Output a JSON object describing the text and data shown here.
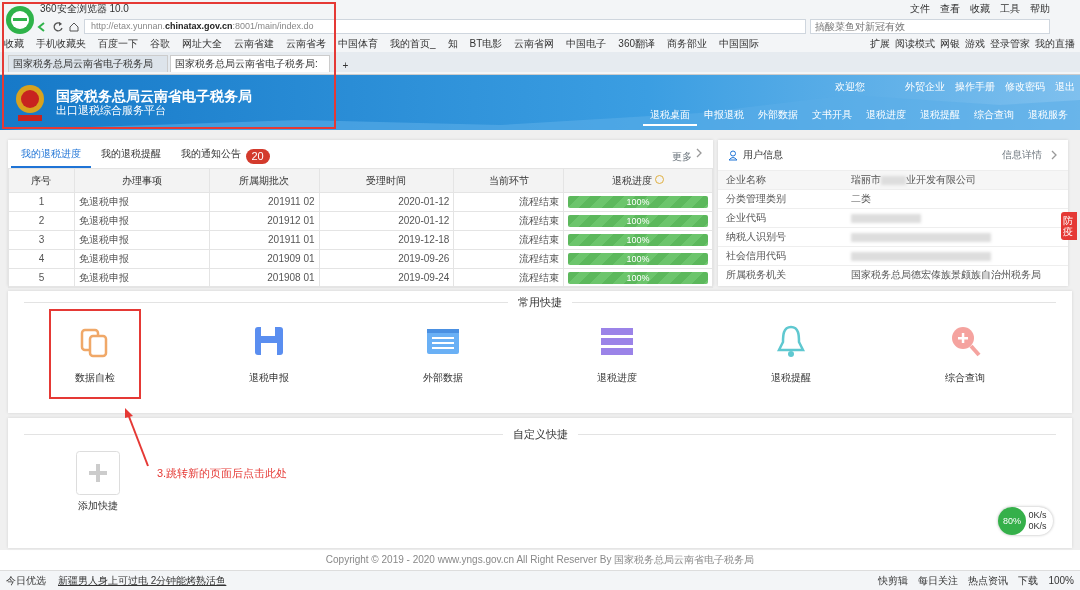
{
  "browser": {
    "title": "360安全浏览器 10.0",
    "menu": [
      "文件",
      "查看",
      "收藏",
      "工具",
      "帮助"
    ],
    "url": {
      "prefix": "http://etax.yunnan.",
      "domain": "chinatax.gov.cn",
      "suffix": ":8001/main/index.do"
    },
    "search": {
      "placeholder": "搞酸菜鱼对新冠有效"
    },
    "bookmarks": [
      "收藏",
      "手机收藏夹",
      "百度一下",
      "谷歌",
      "网址大全",
      "云南省建",
      "云南省考",
      "中国体育",
      "我的首页_",
      "知",
      "BT电影",
      "云南省网",
      "中国电子",
      "360翻译",
      "商务部业",
      "中国国际"
    ],
    "bookmarks_right": [
      "扩展",
      "阅读模式",
      "网银",
      "游戏",
      "登录管家",
      "我的直播"
    ],
    "tabs": [
      {
        "label": "国家税务总局云南省电子税务局",
        "selected": false
      },
      {
        "label": "国家税务总局云南省电子税务局:",
        "selected": true
      }
    ],
    "new_tab": "+"
  },
  "header": {
    "title": "国家税务总局云南省电子税务局",
    "subtitle": "出口退税综合服务平台",
    "welcome": "欢迎您",
    "links": [
      "外贸企业",
      "操作手册",
      "修改密码",
      "退出"
    ],
    "nav": [
      {
        "label": "退税桌面",
        "selected": true
      },
      {
        "label": "申报退税",
        "selected": false
      },
      {
        "label": "外部数据",
        "selected": false
      },
      {
        "label": "文书开具",
        "selected": false
      },
      {
        "label": "退税进度",
        "selected": false
      },
      {
        "label": "退税提醒",
        "selected": false
      },
      {
        "label": "综合查询",
        "selected": false
      },
      {
        "label": "退税服务",
        "selected": false
      }
    ]
  },
  "progress_panel": {
    "tabs": [
      {
        "label": "我的退税进度",
        "selected": true
      },
      {
        "label": "我的退税提醒",
        "selected": false
      },
      {
        "label": "我的通知公告",
        "selected": false,
        "badge": "20"
      }
    ],
    "more": "更多",
    "columns": [
      "序号",
      "办理事项",
      "所属期批次",
      "受理时间",
      "当前环节",
      "退税进度"
    ],
    "rows": [
      {
        "no": "1",
        "item": "免退税申报",
        "period": "201911 02",
        "date": "2020-01-12",
        "stage": "流程结束",
        "level": 1,
        "reading": "100%"
      },
      {
        "no": "2",
        "item": "免退税申报",
        "period": "201912 01",
        "date": "2020-01-12",
        "stage": "流程结束",
        "level": 1,
        "reading": "100%"
      },
      {
        "no": "3",
        "item": "免退税申报",
        "period": "201911 01",
        "date": "2019-12-18",
        "stage": "流程结束",
        "level": 1,
        "reading": "100%"
      },
      {
        "no": "4",
        "item": "免退税申报",
        "period": "201909 01",
        "date": "2019-09-26",
        "stage": "流程结束",
        "level": 1,
        "reading": "100%"
      },
      {
        "no": "5",
        "item": "免退税申报",
        "period": "201908 01",
        "date": "2019-09-24",
        "stage": "流程结束",
        "level": 1,
        "reading": "100%"
      }
    ]
  },
  "user_info": {
    "title": "用户信息",
    "details": "信息详情",
    "fields": [
      {
        "label": "企业名称",
        "value": "瑞丽市",
        "redacted": true,
        "value_after": "业开发有限公司"
      },
      {
        "label": "分类管理类别",
        "value": "二类",
        "redacted": false
      },
      {
        "label": "企业代码",
        "redacted": true
      },
      {
        "label": "纳税人识别号",
        "redacted": true
      },
      {
        "label": "社会信用代码",
        "redacted": true
      },
      {
        "label": "所属税务机关",
        "value": "国家税务总局德宏傣族景颇族自治州税务局",
        "redacted": false
      }
    ]
  },
  "side_tab": "防疫",
  "shortcuts": {
    "title": "常用快捷",
    "items": [
      {
        "kind": "copy",
        "label": "数据自检",
        "highlighted": true
      },
      {
        "kind": "save",
        "label": "退税申报",
        "highlighted": false
      },
      {
        "kind": "list",
        "label": "外部数据",
        "highlighted": false
      },
      {
        "kind": "stack",
        "label": "退税进度",
        "highlighted": false
      },
      {
        "kind": "bell",
        "label": "退税提醒",
        "highlighted": false
      },
      {
        "kind": "zoom",
        "label": "综合查询",
        "highlighted": false
      }
    ]
  },
  "custom_shortcuts": {
    "title": "自定义快捷",
    "add_label": "添加快捷"
  },
  "annotation": {
    "text": "3.跳转新的页面后点击此处",
    "frame_top": true
  },
  "speed_widget": {
    "percent": "80%",
    "up": "0K/s",
    "down": "0K/s"
  },
  "footer": "Copyright © 2019 - 2020 www.yngs.gov.cn All Right Reserver By 国家税务总局云南省电子税务局",
  "status_bar": {
    "left": "今日优选",
    "news": "新疆男人身上可过电 2分钟能烤熟活鱼",
    "items": [
      "快剪辑",
      "每日关注",
      "热点资讯",
      "下载"
    ],
    "zoom": "100%"
  }
}
